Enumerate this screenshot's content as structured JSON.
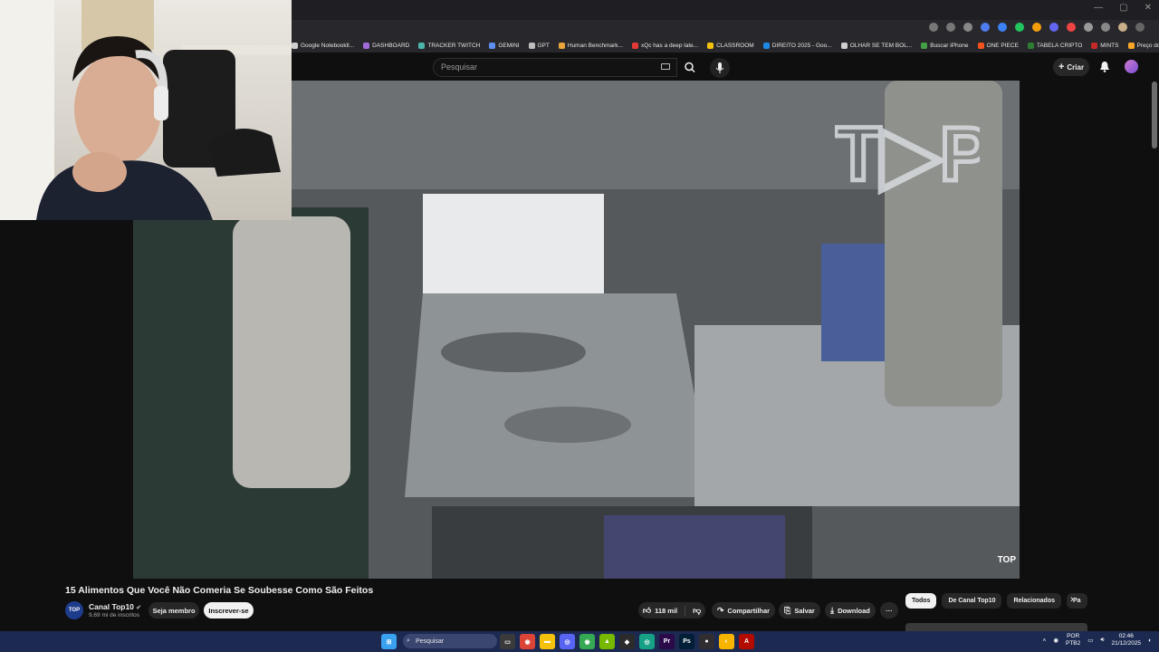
{
  "browser": {
    "window_controls": [
      "—",
      "▢",
      "✕"
    ],
    "bookmarks": [
      {
        "label": "Google Notebooklǀ...",
        "color": "#cfcfcf"
      },
      {
        "label": "DASHBOARD",
        "color": "#a06bd8"
      },
      {
        "label": "TRACKER TWITCH",
        "color": "#4db6ac"
      },
      {
        "label": "GEMINI",
        "color": "#5c8ff0"
      },
      {
        "label": "GPT",
        "color": "#bdbdbd"
      },
      {
        "label": "Human Benchmark...",
        "color": "#e8a53a"
      },
      {
        "label": "xQc has a deep late...",
        "color": "#e53935"
      },
      {
        "label": "CLASSROOM",
        "color": "#f4c20d"
      },
      {
        "label": "DIREITO 2025 - Goo...",
        "color": "#1e88e5"
      },
      {
        "label": "OLHAR SE TEM BOL...",
        "color": "#cfcfcf"
      },
      {
        "label": "Buscar iPhone",
        "color": "#43a047"
      },
      {
        "label": "ONE PIECE",
        "color": "#f4511e"
      },
      {
        "label": "TABELA CRIPTO",
        "color": "#2e7d32"
      },
      {
        "label": "MINTS",
        "color": "#c62828"
      },
      {
        "label": "Preço do Bitcoin",
        "color": "#f9a825"
      }
    ],
    "bookmarks_more": "»"
  },
  "youtube": {
    "search_placeholder": "Pesquisar",
    "create_label": "Criar",
    "video_watermark": "TOP",
    "video": {
      "title": "15 Alimentos Que Você Não Comeria Se Soubesse Como São Feitos",
      "channel_name": "Canal Top10",
      "channel_avatar_text": "TOP",
      "channel_subs": "9,69 mi de inscritos",
      "join_label": "Seja membro",
      "subscribe_label": "Inscrever-se",
      "likes": "118 mil",
      "share_label": "Compartilhar",
      "save_label": "Salvar",
      "download_label": "Download",
      "more_label": "···"
    },
    "chips": [
      "Todos",
      "De Canal Top10",
      "Relacionados",
      "Pa"
    ],
    "chip_next": "›"
  },
  "taskbar": {
    "search_placeholder": "Pesquisar",
    "language": "POR",
    "layout": "PTB2",
    "time": "02:46",
    "date": "21/12/2025",
    "apps": [
      {
        "name": "start",
        "color": "#3aa0f0",
        "glyph": "⊞"
      },
      {
        "name": "search",
        "color": "transparent",
        "glyph": ""
      },
      {
        "name": "task-view",
        "color": "#3a3a3a",
        "glyph": "▭"
      },
      {
        "name": "chrome",
        "color": "#db4437",
        "glyph": "◉"
      },
      {
        "name": "explorer",
        "color": "#f4c20d",
        "glyph": "▬"
      },
      {
        "name": "discord",
        "color": "#5865f2",
        "glyph": "◎"
      },
      {
        "name": "chrome-alt",
        "color": "#34a853",
        "glyph": "◉"
      },
      {
        "name": "nvidia",
        "color": "#76b900",
        "glyph": "▲"
      },
      {
        "name": "app-dark",
        "color": "#2b2b2b",
        "glyph": "◆"
      },
      {
        "name": "app-green",
        "color": "#16a085",
        "glyph": "◎"
      },
      {
        "name": "premiere",
        "color": "#2a0a4a",
        "glyph": "Pr"
      },
      {
        "name": "photoshop",
        "color": "#001e36",
        "glyph": "Ps"
      },
      {
        "name": "app-obs",
        "color": "#302e31",
        "glyph": "●"
      },
      {
        "name": "app-yellow",
        "color": "#f7b500",
        "glyph": "◐"
      },
      {
        "name": "acrobat",
        "color": "#b30b00",
        "glyph": "A"
      }
    ]
  }
}
